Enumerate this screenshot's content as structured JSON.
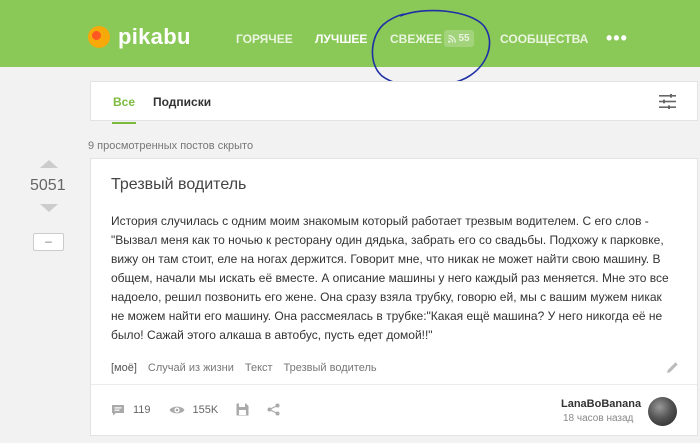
{
  "header": {
    "logo_text": "pikabu",
    "nav": [
      {
        "label": "ГОРЯЧЕЕ"
      },
      {
        "label": "ЛУЧШЕЕ"
      },
      {
        "label": "СВЕЖЕЕ",
        "badge": "55"
      },
      {
        "label": "СООБЩЕСТВА"
      }
    ],
    "more": "•••",
    "accent_color": "#8ac858"
  },
  "feed_tabs": {
    "all": "Все",
    "subscriptions": "Подписки"
  },
  "hidden_note": "9 просмотренных постов скрыто",
  "post": {
    "rating": "5051",
    "minus_label": "–",
    "title": "Трезвый водитель",
    "body": "История случилась с одним моим знакомым который работает трезвым водителем. С его слов - \"Вызвал меня как то ночью к ресторану один дядька, забрать его со свадьбы. Подхожу к парковке, вижу он там стоит, еле на ногах держится. Говорит мне, что никак не может найти свою машину. В общем, начали мы искать её вместе. А описание машины у него каждый раз меняется. Мне это все надоело, решил позвонить его жене. Она сразу взяла трубку, говорю ей, мы с вашим мужем никак не можем найти его машину. Она рассмеялась в трубке:\"Какая ещё машина? У него никогда её не было! Сажай этого алкаша в автобус, пусть едет домой!!\"",
    "tags": [
      "[моё]",
      "Случай из жизни",
      "Текст",
      "Трезвый водитель"
    ],
    "comments": "119",
    "views": "155K",
    "author": "LanaBoBanana",
    "time": "18 часов назад"
  }
}
